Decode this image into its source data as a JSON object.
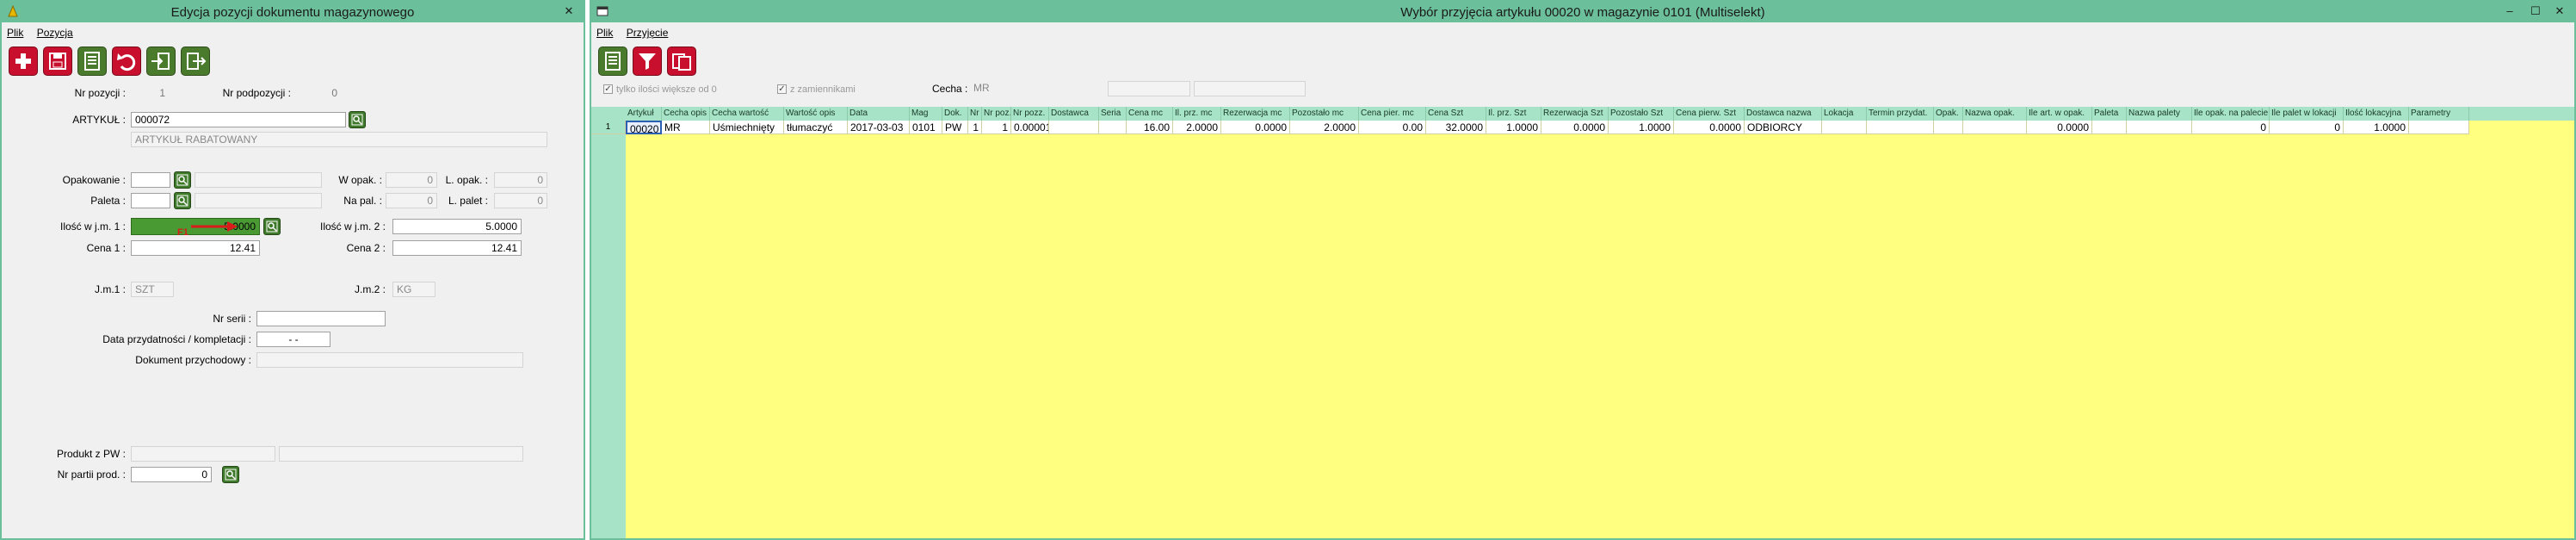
{
  "win1": {
    "title": "Edycja pozycji dokumentu magazynowego",
    "close": "✕",
    "menu": {
      "plik": "Plik",
      "pozycja": "Pozycja"
    },
    "toolbar": [
      "plus-icon",
      "save-icon",
      "list-icon",
      "undo-icon",
      "import-icon",
      "export-icon"
    ],
    "form": {
      "nr_pozycji_label": "Nr pozycji :",
      "nr_pozycji_value": "1",
      "nr_podpozycji_label": "Nr podpozycji :",
      "nr_podpozycji_value": "0",
      "artykul_label": "ARTYKUŁ :",
      "artykul_value": "000072",
      "artykul_name": "ARTYKUŁ RABATOWANY",
      "opakowanie_label": "Opakowanie :",
      "w_opak_label": "W opak. :",
      "w_opak_value": "0",
      "l_opak_label": "L. opak. :",
      "l_opak_value": "0",
      "paleta_label": "Paleta :",
      "na_pal_label": "Na pal. :",
      "na_pal_value": "0",
      "l_palet_label": "L. palet :",
      "l_palet_value": "0",
      "ilosc1_label": "Ilość w j.m. 1 :",
      "ilosc1_value": "5.0000",
      "f1_tag": "F1",
      "ilosc2_label": "Ilość w j.m. 2 :",
      "ilosc2_value": "5.0000",
      "cena1_label": "Cena 1 :",
      "cena1_value": "12.41",
      "cena2_label": "Cena 2 :",
      "cena2_value": "12.41",
      "jm1_label": "J.m.1 :",
      "jm1_value": "SZT",
      "jm2_label": "J.m.2 :",
      "jm2_value": "KG",
      "nr_serii_label": "Nr serii :",
      "data_przyd_label": "Data przydatności / kompletacji :",
      "data_przyd_value": "- -",
      "dokument_przych_label": "Dokument przychodowy :",
      "produkt_pw_label": "Produkt z PW :",
      "nr_partii_label": "Nr partii prod. :",
      "nr_partii_value": "0"
    }
  },
  "win2": {
    "title": "Wybór przyjęcia artykułu 00020  w magazynie 0101 (Multiselekt)",
    "controls": {
      "min": "–",
      "max": "☐",
      "close": "✕"
    },
    "menu": {
      "plik": "Plik",
      "przyjecie": "Przyjęcie"
    },
    "toolbar": [
      "list-icon",
      "filter-icon",
      "copy-icon"
    ],
    "filters": {
      "tylko_ilosci": "tylko ilości większe od 0",
      "z_zamiennikami": "z zamiennikami",
      "cecha_label": "Cecha :",
      "cecha_value": "MR"
    },
    "columns": [
      "Artykuł",
      "Cecha opis",
      "Cecha wartość",
      "Wartość opis",
      "Data",
      "Mag",
      "Dok.",
      "Nr",
      "Nr poz.",
      "Nr pozz.",
      "Dostawca",
      "Seria",
      "Cena mc",
      "Il. prz. mc",
      "Rezerwacja mc",
      "Pozostało mc",
      "Cena pier. mc",
      "Cena Szt",
      "Il. prz. Szt",
      "Rezerwacja Szt",
      "Pozostało Szt",
      "Cena pierw. Szt",
      "Dostawca nazwa",
      "Lokacja",
      "Termin przydat.",
      "Opak.",
      "Nazwa opak.",
      "Ile art. w opak.",
      "Paleta",
      "Nazwa palety",
      "Ile opak. na palecie",
      "Ile palet w lokacji",
      "Ilość lokacyjna",
      "Parametry"
    ],
    "rows": [
      {
        "rownum": "1",
        "cells": [
          "00020",
          "MR",
          "Uśmiechnięty",
          "tłumaczyć",
          "2017-03-03",
          "0101",
          "PW",
          "1",
          "1",
          "0.00001",
          "",
          "",
          "16.00",
          "2.0000",
          "0.0000",
          "2.0000",
          "0.00",
          "32.0000",
          "1.0000",
          "0.0000",
          "1.0000",
          "0.0000",
          "ODBIORCY",
          "",
          "",
          "",
          "",
          "0.0000",
          "",
          "",
          "0",
          "0",
          "1.0000",
          ""
        ]
      }
    ]
  },
  "colors": {
    "titlebar": "#6bbf9a",
    "grid": "#ffff80",
    "gridhead": "#a7e3c6",
    "btn_red": "#c8102e",
    "btn_green": "#4a7a2c"
  }
}
